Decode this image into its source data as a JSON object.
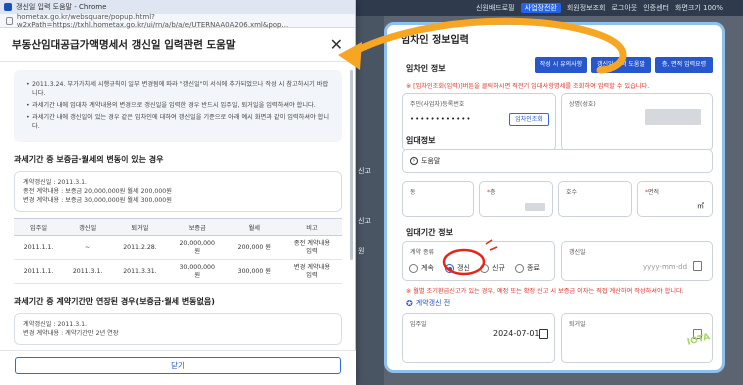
{
  "background": {
    "top_nav": [
      "신원배드로필",
      "사업장전환",
      "회원정보조회",
      "로그아웃",
      "인증센터",
      "화면크기 100%"
    ],
    "left_items": [
      "신고",
      "신고",
      "원"
    ]
  },
  "popup": {
    "window_title": "갱신일 입력 도움말 - Chrome",
    "url": "hometax.go.kr/websquare/popup.html?w2xPath=https://txhl.hometax.go.kr/ui/rn/a/b/a/e/UTERNAA0A206.xml&pop...",
    "header": "부동산임대공급가액명세서 갱신일 입력관련 도움말",
    "notes": [
      "2011.3.24. 부가가치세 시행규칙이 일부 변경됨에 따라 \"갱신일\"이 서식에 추가되었으나 작성 시 참고하시기 바랍니다.",
      "과세기간 내에 임대차 계약내용의 변경으로 갱신일을 입력한 경우 반드시 입주일, 퇴거일을 입력하셔야 합니다.",
      "과세기간 내에 갱신일이 있는 경우 같은 임차인에 대하여 갱신일을 기준으로 아래 예시 화면과 같이 입력하셔야 합니다."
    ],
    "section1_title": "과세기간 중 보증금·월세의 변동이 있는 경우",
    "section1_info": [
      "계약갱신일 : 2011.3.1.",
      "종전 계약내용 : 보증금 20,000,000원 월세 200,000원",
      "변경 계약내용 : 보증금 30,000,000원 월세 300,000원"
    ],
    "table": {
      "headers": [
        "입주일",
        "갱신일",
        "퇴거일",
        "보증금",
        "월세",
        "비고"
      ],
      "rows": [
        [
          "2011.1.1.",
          "~",
          "2011.2.28.",
          "20,000,000\n원",
          "200,000 원",
          "종전 계약내용\n입력"
        ],
        [
          "2011.1.1.",
          "2011.3.1.",
          "2011.3.31.",
          "30,000,000\n원",
          "300,000 원",
          "변경 계약내용\n입력"
        ]
      ]
    },
    "section2_title": "과세기간 중 계약기간만 연장된 경우(보증금·월세 변동없음)",
    "section2_info": [
      "계약갱신일 : 2011.3.1.",
      "변경 계약내용 : 계약기간만 2년 연장"
    ],
    "confirm_label": "닫기"
  },
  "form": {
    "title": "임차인 정보입력",
    "top_buttons": [
      "작성 시 유의사항",
      "갱신일 입력 도움말",
      "층, 면적 입력요령"
    ],
    "lessee_section": "임차인 정보",
    "lessee_note": "※ [임차인조회(입력)]버튼을 클릭하시면 직전기 임대사항명세를 조회하여 입력할 수 있습니다.",
    "id_label": "주민(사업자)등록번호",
    "id_value": "••••••••••••",
    "id_button": "임차인조회",
    "name_label": "상명(성호)",
    "lease_section": "임대정보",
    "help_label": "도움말",
    "dong_label": "동",
    "floor_label": "층",
    "ho_label": "호수",
    "area_label": "면적",
    "area_unit": "㎡",
    "period_section": "임대기간 정보",
    "contract_type_label": "계약 종류",
    "options": [
      "계속",
      "갱신",
      "신규",
      "종료"
    ],
    "selected_option": "갱신",
    "renew_label": "갱신일",
    "renew_placeholder": "yyyy-mm-dd",
    "period_note": "※ 월별 조기환급신고가 있는 경우, 예정 또는 확정 신고 시 보증금 이자는 직접 계산하여 작성하셔야 합니다.",
    "pre_renewal": "계약갱신 전",
    "movein_label": "입주일",
    "movein_value": "2024-07-01",
    "moveout_label": "퇴거일",
    "watermark": "IOTA"
  }
}
